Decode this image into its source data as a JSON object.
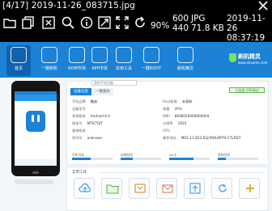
{
  "viewer": {
    "title": "[4/17]  2019-11-26_083715.jpg",
    "zoom": "90%",
    "resolution_w": "600",
    "resolution_h": "440",
    "format": "JPG",
    "filesize": "71.8 KB",
    "date": "2019-11-26",
    "time": "08:37:19",
    "tools": [
      "folder-open-icon",
      "copy-icon",
      "delete-icon",
      "search-icon",
      "info-icon",
      "resize-icon",
      "fullscreen-icon",
      "rotate-icon"
    ],
    "text_color": "#ffffff",
    "bg_color": "#000000"
  },
  "app": {
    "header_color": "#1b82d6",
    "nav_items": [
      {
        "label": "首页",
        "icon": "home-icon"
      },
      {
        "label": "一键刷机",
        "icon": "rocket-icon"
      },
      {
        "label": "ROM市场",
        "icon": "rom-icon"
      },
      {
        "label": "APP市场",
        "icon": "app-market-icon"
      },
      {
        "label": "实用工具",
        "icon": "toolbox-icon"
      },
      {
        "label": "一键ROOT",
        "icon": "root-icon"
      },
      {
        "label": "刷机精灵",
        "icon": "assistant-icon"
      }
    ],
    "brand_name": "刷机精灵",
    "brand_url": "www.shuame.com",
    "device_tabs": [
      "设备信息",
      "一键备份"
    ],
    "breadcrumb": "我的手机设备",
    "battery_status": "已连接 USB调试",
    "info": [
      {
        "label": "手机品牌",
        "value": "魅族"
      },
      {
        "label": "设备型号",
        "value": ""
      },
      {
        "label": "系统版本",
        "value": "Android 6.0"
      },
      {
        "label": "版本号",
        "value": "MT6750T"
      },
      {
        "label": "基带版本",
        "value": ""
      },
      {
        "label": "序列号",
        "value": "unknown"
      }
    ],
    "info_right": [
      {
        "label": "Root权限",
        "value": "未获取"
      },
      {
        "label": "电量",
        "value": "20%"
      },
      {
        "label": "IMEI",
        "value": "8648020000000004"
      },
      {
        "label": "分辨率",
        "value": "1920"
      },
      {
        "label": "CPU",
        "value": ""
      },
      {
        "label": "硬件地址",
        "value": "MDL:11:B22:EUJ:MDLMFP4:C7LRD7"
      }
    ],
    "storage": [
      {
        "label": "手机内存",
        "fill": 0.45
      },
      {
        "label": "存储空间",
        "fill": 0.3
      },
      {
        "label": "SD卡",
        "fill": 0.6
      },
      {
        "label": "系统空间",
        "fill": 0.2
      }
    ],
    "tools_title": "实用工具",
    "tools": [
      "cloud-backup-icon",
      "folder-icon",
      "flash-icon",
      "restore-icon",
      "upload-icon",
      "sync-icon",
      "add-icon"
    ]
  }
}
